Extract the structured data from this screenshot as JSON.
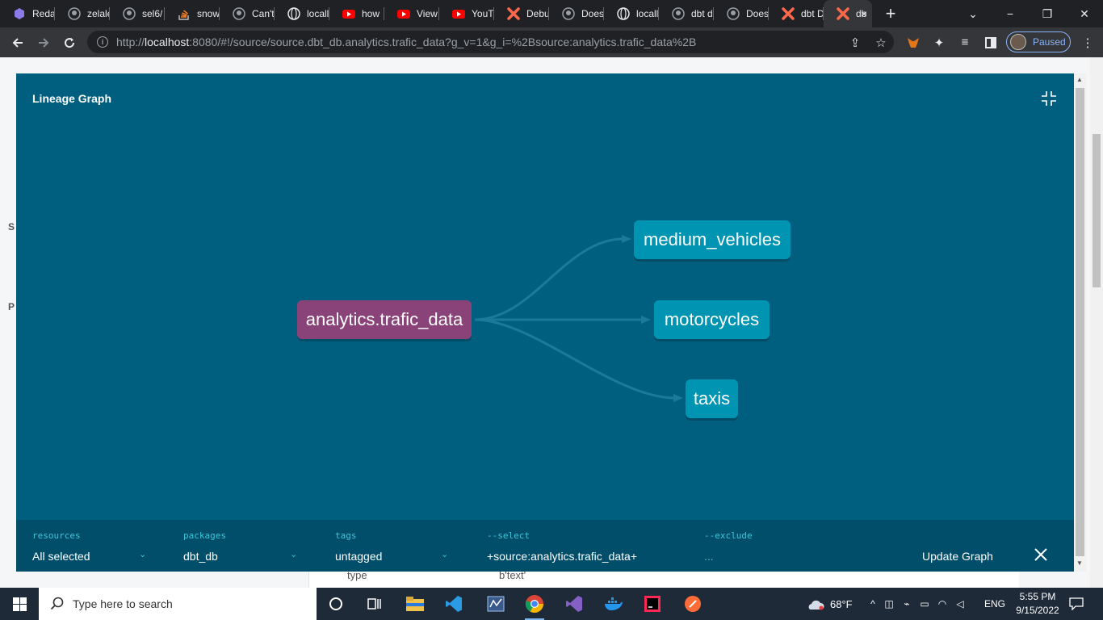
{
  "browser": {
    "tabs": [
      {
        "title": "Reda",
        "icon": "purple-hexagon-icon"
      },
      {
        "title": "zelale",
        "icon": "github-icon"
      },
      {
        "title": "sel6/",
        "icon": "github-icon"
      },
      {
        "title": "snow",
        "icon": "stackoverflow-icon"
      },
      {
        "title": "Can't",
        "icon": "github-icon"
      },
      {
        "title": "locall",
        "icon": "globe-icon"
      },
      {
        "title": "how",
        "icon": "youtube-icon"
      },
      {
        "title": "View",
        "icon": "youtube-icon"
      },
      {
        "title": "YouT",
        "icon": "youtube-icon"
      },
      {
        "title": "Debu",
        "icon": "dbt-icon"
      },
      {
        "title": "Does",
        "icon": "github-icon"
      },
      {
        "title": "locall",
        "icon": "globe-icon"
      },
      {
        "title": "dbt d",
        "icon": "github-icon"
      },
      {
        "title": "Does",
        "icon": "github-icon"
      },
      {
        "title": "dbt D",
        "icon": "dbt-icon"
      }
    ],
    "active_tab": {
      "title": "db",
      "icon": "dbt-icon",
      "close": "×"
    },
    "new_tab": "+",
    "window_controls": {
      "minimize": "⌄",
      "restore": "−",
      "maximize": "❐",
      "close": "✕"
    },
    "url_host": "localhost",
    "url_scheme": "http://",
    "url_rest": ":8080/#!/source/source.dbt_db.analytics.trafic_data?g_v=1&g_i=%2Bsource:analytics.trafic_data%2B",
    "profile_status": "Paused"
  },
  "page_behind": {
    "row_key": "type",
    "row_value": "b'text'",
    "left_label_1": "S",
    "left_label_2": "P"
  },
  "lineage": {
    "title": "Lineage Graph",
    "source_node": "analytics.trafic_data",
    "child_nodes": [
      "medium_vehicles",
      "motorcycles",
      "taxis"
    ],
    "colors": {
      "modal_bg": "#005f7f",
      "source_node": "#8a4378",
      "model_node": "#0094b3",
      "edge": "#1c7a99"
    }
  },
  "filters": {
    "resources": {
      "label": "resources",
      "value": "All selected"
    },
    "packages": {
      "label": "packages",
      "value": "dbt_db"
    },
    "tags": {
      "label": "tags",
      "value": "untagged"
    },
    "select": {
      "label": "--select",
      "value": "+source:analytics.trafic_data+"
    },
    "exclude": {
      "label": "--exclude",
      "value": "..."
    },
    "update_button": "Update Graph"
  },
  "taskbar": {
    "search_placeholder": "Type here to search",
    "weather": "68°F",
    "language": "ENG",
    "time": "5:55 PM",
    "date": "9/15/2022"
  }
}
